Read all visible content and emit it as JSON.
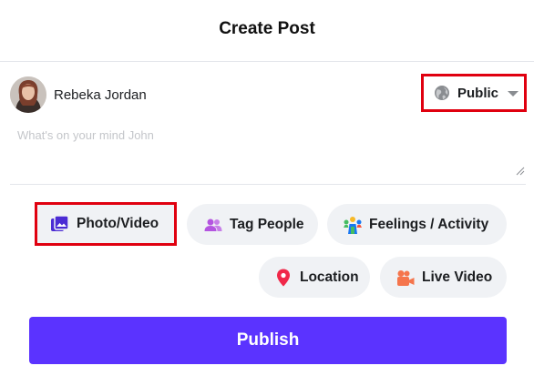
{
  "dialog": {
    "title": "Create Post"
  },
  "user": {
    "name": "Rebeka Jordan",
    "avatar_icon": "user-avatar"
  },
  "privacy": {
    "label": "Public",
    "icon": "globe-icon"
  },
  "composer": {
    "placeholder": "What's on your mind John",
    "value": ""
  },
  "actions": {
    "photo_video": {
      "label": "Photo/Video",
      "icon": "photo-video-icon",
      "color": "#4b2bd4"
    },
    "tag_people": {
      "label": "Tag People",
      "icon": "tag-people-icon",
      "color": "#b455e0"
    },
    "feelings": {
      "label": "Feelings / Activity",
      "icon": "feelings-activity-icon"
    },
    "location": {
      "label": "Location",
      "icon": "location-pin-icon",
      "color": "#f02849"
    },
    "live_video": {
      "label": "Live Video",
      "icon": "live-video-icon",
      "color": "#f5754c"
    }
  },
  "publish": {
    "label": "Publish",
    "color": "#5b33ff"
  },
  "highlight_color": "#e0000f"
}
